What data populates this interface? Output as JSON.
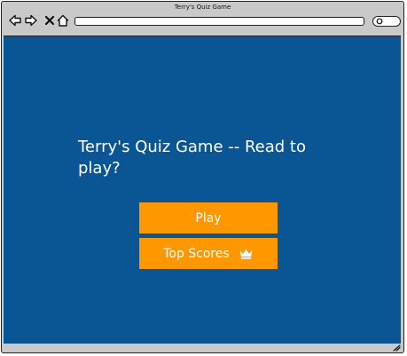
{
  "browser": {
    "title": "Terry's Quiz Game",
    "address": "",
    "icons": {
      "back": "arrow-left-icon",
      "forward": "arrow-right-icon",
      "stop": "close-icon",
      "home": "home-icon",
      "search": "search-icon",
      "resize": "resize-grip-icon"
    }
  },
  "page": {
    "background_color": "#0a5593",
    "heading": "Terry's Quiz Game -- Read to play?",
    "buttons": {
      "play_label": "Play",
      "scores_label": "Top Scores",
      "scores_icon": "crown-icon",
      "color": "#ff9800"
    }
  }
}
